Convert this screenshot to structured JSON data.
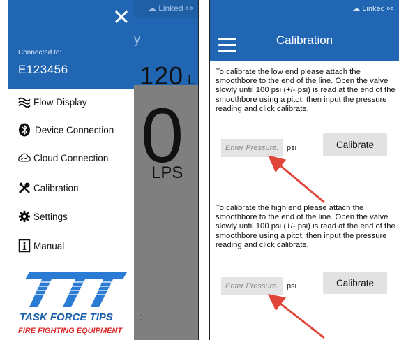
{
  "left_screen": {
    "status": {
      "linked": "Linked"
    },
    "background": {
      "flow_top": "120",
      "flow_top_unit": "L",
      "flow_big": "0",
      "flow_unit": "LPS"
    },
    "drawer": {
      "close_glyph": "✕",
      "connected_label": "Connected to:",
      "device_id": "E123456",
      "items": [
        {
          "label": "Flow Display",
          "icon": "flow-waves-icon"
        },
        {
          "label": "Device Connection",
          "icon": "bluetooth-icon"
        },
        {
          "label": "Cloud Connection",
          "icon": "cloud-icon"
        },
        {
          "label": "Calibration",
          "icon": "wrench-screwdriver-icon"
        },
        {
          "label": "Settings",
          "icon": "gear-icon"
        },
        {
          "label": "Manual",
          "icon": "info-book-icon"
        }
      ],
      "logo": {
        "brand": "TASK FORCE TIPS",
        "tagline": "FIRE FIGHTING EQUIPMENT"
      }
    }
  },
  "right_screen": {
    "status": {
      "linked": "Linked"
    },
    "title": "Calibration",
    "low": {
      "instructions": "To calibrate the low end please attach the smoothbore to the end of the line. Open the valve slowly until 100 psi (+/-  psi) is read at the end of the smoothbore using a pitot, then input the pressure reading and click calibrate.",
      "placeholder": "Enter Pressure...",
      "unit": "psi",
      "button": "Calibrate"
    },
    "high": {
      "instructions": "To calibrate the high end please attach the smoothbore to the end of the line. Open the valve slowly until 100 psi (+/-  psi) is read at the end of the smoothbore using a pitot, then input the pressure reading and click calibrate.",
      "placeholder": "Enter Pressure...",
      "unit": "psi",
      "button": "Calibrate"
    },
    "colors": {
      "primary": "#2066b3",
      "arrow": "#e0453a"
    }
  }
}
